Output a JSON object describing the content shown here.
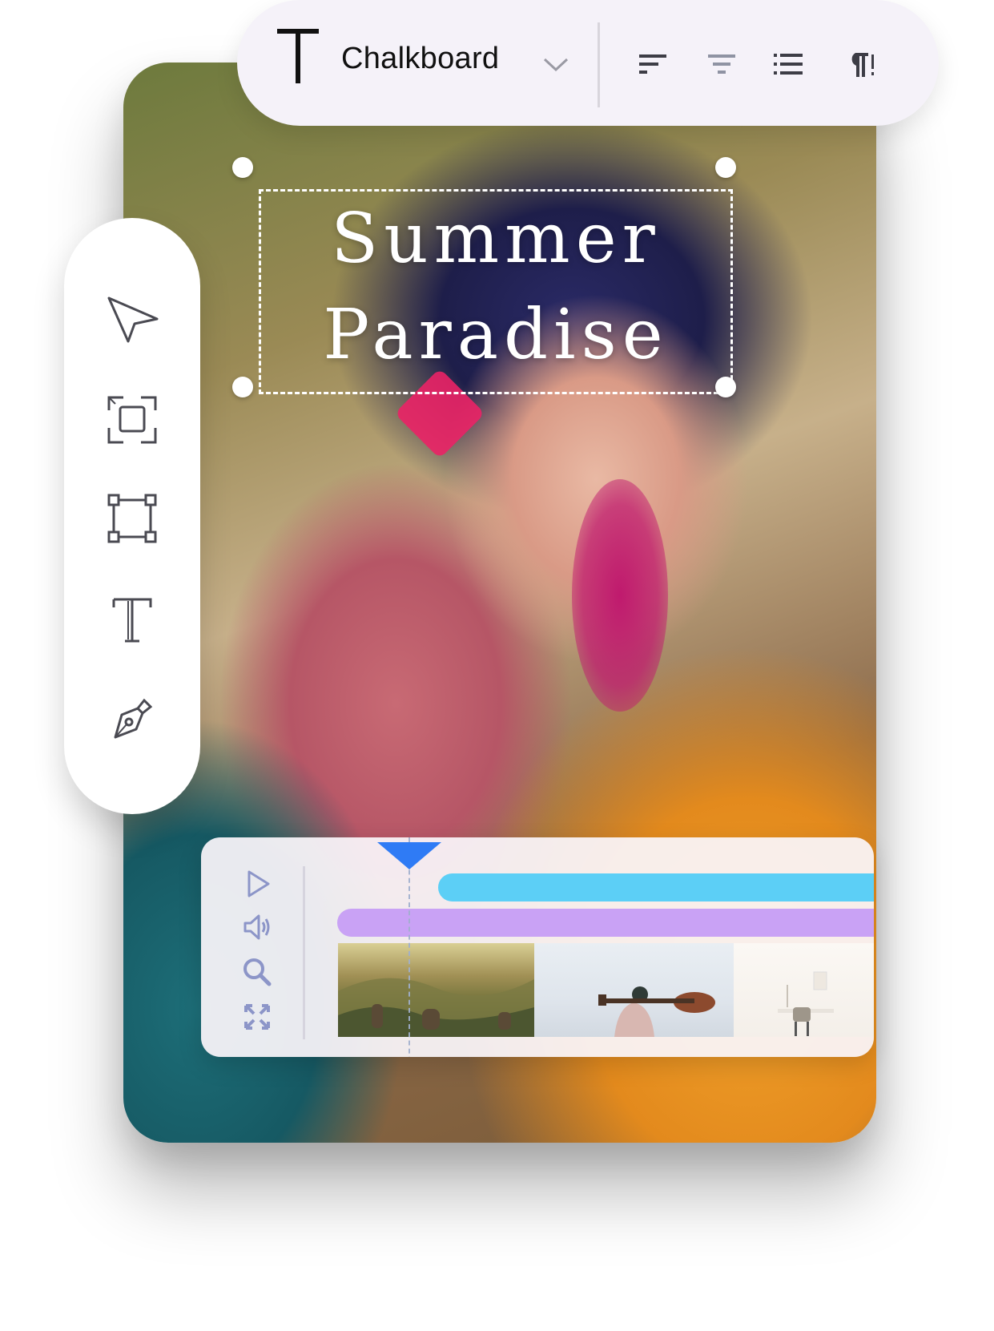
{
  "toolbar": {
    "font_name": "Chalkboard",
    "icons": [
      "text-t-icon",
      "chevron-down-icon",
      "align-left-icon",
      "align-center-icon",
      "list-bullets-icon",
      "paragraph-icon"
    ]
  },
  "canvas": {
    "title_line1": "Summer",
    "title_line2": "Paradise"
  },
  "tools": [
    "cursor-arrow-icon",
    "focus-frame-icon",
    "crop-frame-icon",
    "text-tool-icon",
    "pen-tool-icon"
  ],
  "timeline": {
    "controls": [
      "play-icon",
      "volume-icon",
      "zoom-icon",
      "fit-expand-icon"
    ],
    "track_colors": {
      "text_track": "#5ccff6",
      "audio_track": "#c9a2f5"
    },
    "playhead_color": "#2f7bf5",
    "clips": [
      "landscape-clip",
      "guitarist-clip",
      "interior-clip"
    ]
  },
  "colors": {
    "icon_gray": "#4a4a52",
    "toolbar_bg": "#f5f2f9",
    "control_icon": "#8c95c8"
  }
}
